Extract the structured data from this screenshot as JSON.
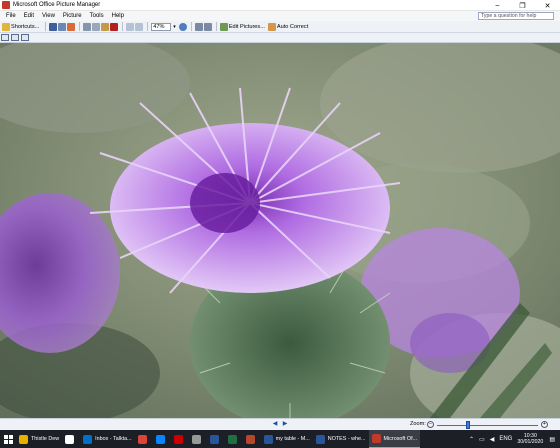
{
  "window": {
    "title": "Microsoft Office Picture Manager",
    "minimize": "–",
    "maximize": "❐",
    "close": "✕"
  },
  "menu": {
    "items": [
      "File",
      "Edit",
      "View",
      "Picture",
      "Tools",
      "Help"
    ],
    "help_placeholder": "Type a question for help"
  },
  "toolbar": {
    "shortcuts_label": "Shortcuts...",
    "zoom_value": "47%",
    "edit_pictures_label": "Edit Pictures...",
    "auto_correct_label": "Auto Correct"
  },
  "statusbar": {
    "prev_arrow": "◀",
    "next_arrow": "▶",
    "zoom_label": "Zoom:",
    "zoom_minus": "−",
    "zoom_plus": "+",
    "zoom_level_fraction": 0.3
  },
  "taskbar": {
    "items": [
      {
        "label": "Thistle Dew",
        "icon_color": "#e8b100"
      },
      {
        "label": "",
        "icon_color": "#ffffff"
      },
      {
        "label": "Inbox - Talkta...",
        "icon_color": "#0072c6"
      },
      {
        "label": "",
        "icon_color": "#db4437"
      },
      {
        "label": "",
        "icon_color": "#0a84ff"
      },
      {
        "label": "",
        "icon_color": "#c00"
      },
      {
        "label": "",
        "icon_color": "#999"
      },
      {
        "label": "",
        "icon_color": "#2a5699"
      },
      {
        "label": "",
        "icon_color": "#1f6f43"
      },
      {
        "label": "",
        "icon_color": "#b7472a"
      },
      {
        "label": "my table - M...",
        "icon_color": "#2a5699"
      },
      {
        "label": "NOTES - whe...",
        "icon_color": "#2a5699"
      },
      {
        "label": "Microsoft Of...",
        "icon_color": "#c0392b"
      }
    ],
    "tray_lang": "ENG",
    "time": "10:30",
    "date": "30/01/2020"
  },
  "colors": {
    "accent": "#3c7bd9",
    "taskbar": "#1d1f26",
    "canvas_bg": "#7d8a73",
    "thistle_purple": "#b16be0"
  }
}
